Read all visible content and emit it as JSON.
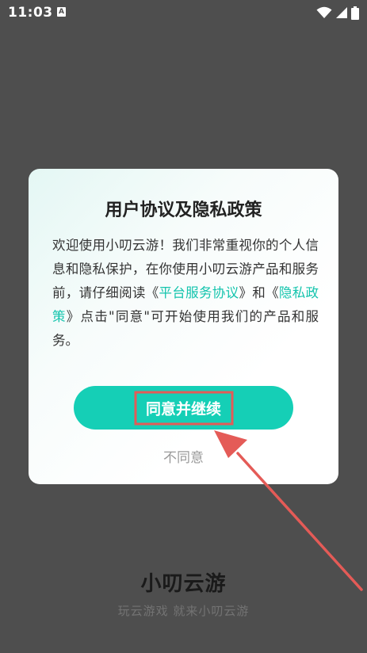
{
  "status_bar": {
    "time": "11:03",
    "notification_letter": "A"
  },
  "dialog": {
    "title": "用户协议及隐私政策",
    "body_prefix": "欢迎使用小叨云游！我们非常重视你的个人信息和隐私保护，在你使用小叨云游产品和服务前，请仔细阅读《",
    "link_service": "平台服务协议",
    "body_mid": "》和《",
    "link_privacy": "隐私政策",
    "body_suffix": "》点击\"同意\"可开始使用我们的产品和服务。",
    "agree_label": "同意并继续",
    "disagree_label": "不同意"
  },
  "brand": {
    "name": "小叨云游",
    "slogan": "玩云游戏 就来小叨云游"
  },
  "colors": {
    "accent": "#15cfb6",
    "link": "#14c4ad",
    "annotation_red": "#e45b57",
    "overlay": "#4e4e4e"
  }
}
